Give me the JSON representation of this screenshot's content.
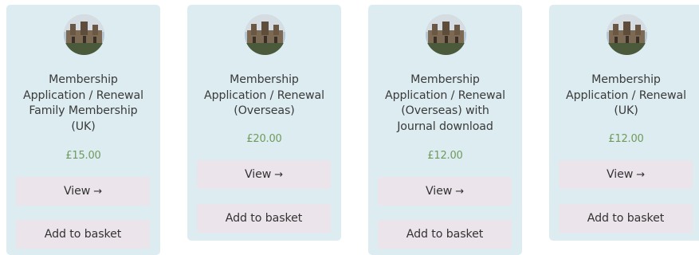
{
  "products": [
    {
      "title_lines": [
        "Membership",
        "Application / Renewal",
        "Family Membership",
        "(UK)"
      ],
      "price": "£15.00",
      "view_label": "View",
      "view_arrow": "→",
      "basket_label": "Add to basket"
    },
    {
      "title_lines": [
        "Membership",
        "Application / Renewal",
        "(Overseas)"
      ],
      "price": "£20.00",
      "view_label": "View",
      "view_arrow": "→",
      "basket_label": "Add to basket"
    },
    {
      "title_lines": [
        "Membership",
        "Application / Renewal",
        "(Overseas) with",
        "Journal download"
      ],
      "price": "£12.00",
      "view_label": "View",
      "view_arrow": "→",
      "basket_label": "Add to basket"
    },
    {
      "title_lines": [
        "Membership",
        "Application / Renewal",
        "(UK)"
      ],
      "price": "£12.00",
      "view_label": "View",
      "view_arrow": "→",
      "basket_label": "Add to basket"
    }
  ],
  "colors": {
    "card_background": "#dcecf1",
    "button_background": "#ebe4ea",
    "price_text": "#6f9a5c",
    "title_text": "#3a3a3a"
  },
  "icons": {
    "product_image": "castle-photo-icon",
    "view_arrow": "arrow-right-icon"
  }
}
